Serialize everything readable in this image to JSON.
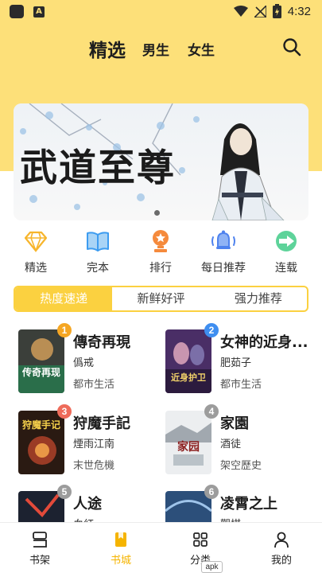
{
  "status_bar": {
    "time": "4:32",
    "app_icon_letter": "A"
  },
  "header": {
    "tabs": [
      {
        "label": "精选",
        "active": true
      },
      {
        "label": "男生"
      },
      {
        "label": "女生"
      }
    ]
  },
  "banner": {
    "title": "武道至尊"
  },
  "categories": [
    {
      "label": "精选",
      "icon": "diamond-icon"
    },
    {
      "label": "完本",
      "icon": "book-icon"
    },
    {
      "label": "排行",
      "icon": "medal-icon"
    },
    {
      "label": "每日推荐",
      "icon": "bell-icon"
    },
    {
      "label": "连载",
      "icon": "play-arrow-icon"
    }
  ],
  "segments": [
    {
      "label": "热度速递",
      "active": true
    },
    {
      "label": "新鲜好评"
    },
    {
      "label": "强力推荐"
    }
  ],
  "books": [
    {
      "rank": "1",
      "title": "傳奇再現",
      "author": "僞戒",
      "genre": "都市生活",
      "cover_text": "传奇再现"
    },
    {
      "rank": "2",
      "title": "女神的近身...",
      "author": "肥茹子",
      "genre": "都市生活",
      "cover_text": "近身护卫"
    },
    {
      "rank": "3",
      "title": "狩魔手記",
      "author": "煙雨江南",
      "genre": "末世危機",
      "cover_text": "狩魔手记"
    },
    {
      "rank": "4",
      "title": "家園",
      "author": "酒徒",
      "genre": "架空歷史",
      "cover_text": "家园"
    },
    {
      "rank": "5",
      "title": "人途",
      "author": "血紅",
      "genre": ""
    },
    {
      "rank": "6",
      "title": "凌霄之上",
      "author": "觀棋",
      "genre": ""
    }
  ],
  "bottom_nav": [
    {
      "label": "书架",
      "icon": "bookshelf-icon"
    },
    {
      "label": "书城",
      "icon": "bookstore-icon",
      "active": true
    },
    {
      "label": "分类",
      "icon": "grid-icon"
    },
    {
      "label": "我的",
      "icon": "user-icon"
    }
  ],
  "apk_label": "apk",
  "colors": {
    "accent": "#fbd140",
    "header_bg": "#fde079",
    "active_nav": "#f5b400"
  }
}
